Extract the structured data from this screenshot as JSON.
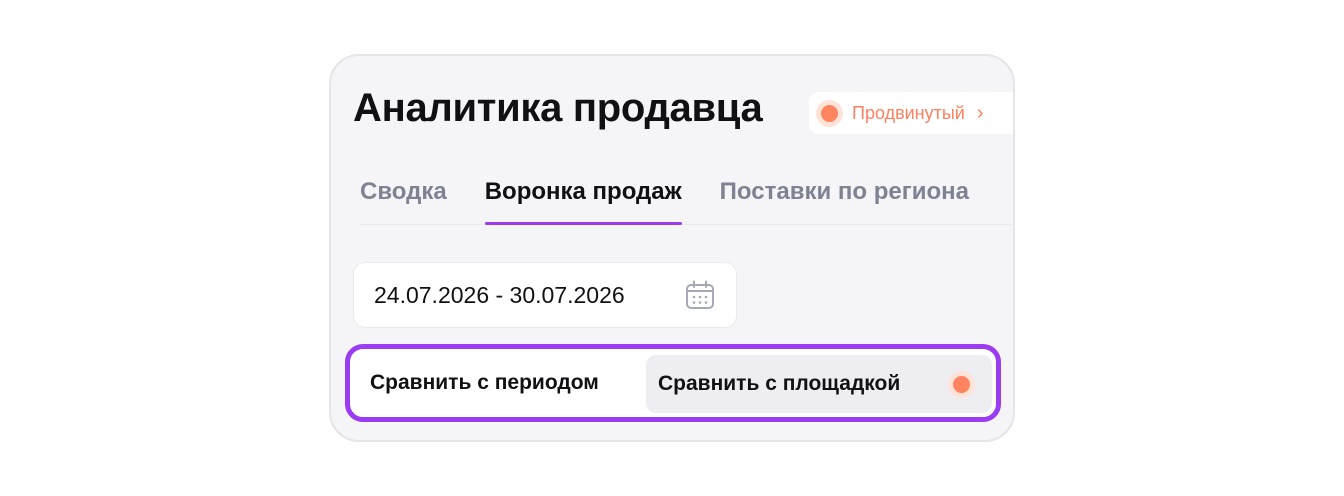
{
  "header": {
    "title": "Аналитика продавца",
    "plan_badge": {
      "label": "Продвинутый",
      "chevron": "›",
      "accent": "#ff7f5e"
    }
  },
  "tabs": [
    {
      "label": "Сводка",
      "active": false
    },
    {
      "label": "Воронка продаж",
      "active": true
    },
    {
      "label": "Поставки по региона",
      "active": false
    }
  ],
  "date_range": {
    "value": "24.07.2026 - 30.07.2026",
    "icon": "calendar-icon"
  },
  "compare": {
    "period_label": "Сравнить с периодом",
    "platform_label": "Сравнить с площадкой",
    "highlight_color": "#9b3cf3"
  }
}
